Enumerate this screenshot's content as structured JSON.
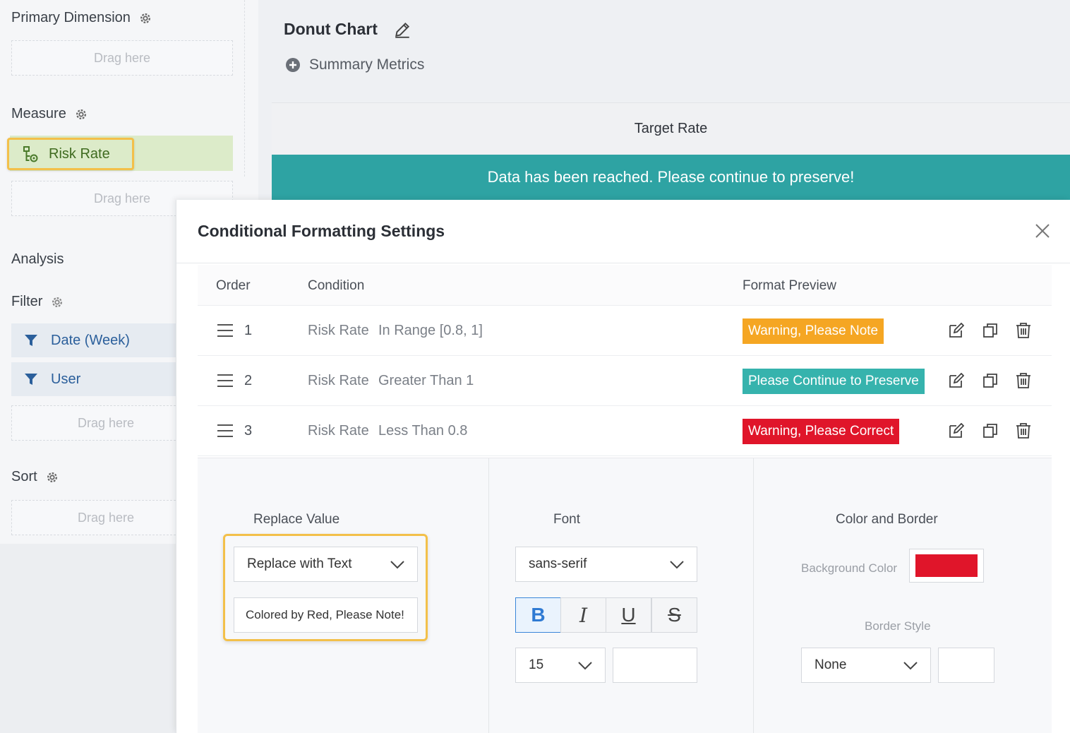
{
  "sidebar": {
    "primary_dimension": {
      "title": "Primary Dimension",
      "drop": "Drag here"
    },
    "measure": {
      "title": "Measure",
      "item": "Risk Rate",
      "drop": "Drag here"
    },
    "analysis": {
      "title": "Analysis"
    },
    "filter": {
      "title": "Filter",
      "items": [
        "Date (Week)",
        "User"
      ],
      "drop": "Drag here"
    },
    "sort": {
      "title": "Sort",
      "drop": "Drag here"
    }
  },
  "chart": {
    "title": "Donut Chart",
    "summary_metrics": "Summary Metrics",
    "target_header": "Target Rate",
    "banner_text": "Data has been reached. Please continue to preserve!"
  },
  "modal": {
    "title": "Conditional Formatting Settings",
    "columns": {
      "order": "Order",
      "condition": "Condition",
      "format_preview": "Format Preview"
    },
    "rules": [
      {
        "order": "1",
        "field": "Risk Rate",
        "condition": "In Range [0.8, 1]",
        "preview": "Warning, Please Note",
        "color": "#f5a623"
      },
      {
        "order": "2",
        "field": "Risk Rate",
        "condition": "Greater Than 1",
        "preview": "Please Continue to Preserve",
        "color": "#36b3ad"
      },
      {
        "order": "3",
        "field": "Risk Rate",
        "condition": "Less Than 0.8",
        "preview": "Warning, Please Correct",
        "color": "#e0152a"
      }
    ],
    "replace_value": {
      "label": "Replace Value",
      "mode": "Replace with Text",
      "text": "Colored by Red, Please Note!"
    },
    "font": {
      "label": "Font",
      "family": "sans-serif",
      "bold": "B",
      "italic": "I",
      "underline": "U",
      "strike": "S",
      "size": "15",
      "color": ""
    },
    "color_border": {
      "label": "Color and Border",
      "background_label": "Background Color",
      "background_color": "#e0152a",
      "border_label": "Border Style",
      "border_style": "None"
    }
  },
  "colors": {
    "accent_teal": "#2ea3a3",
    "highlight": "#f3c04a",
    "measure_green": "#dcebc9"
  }
}
